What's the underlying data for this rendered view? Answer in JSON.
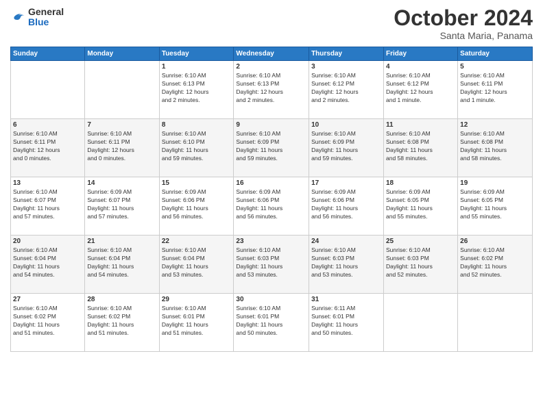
{
  "logo": {
    "general": "General",
    "blue": "Blue"
  },
  "header": {
    "month": "October 2024",
    "location": "Santa Maria, Panama"
  },
  "weekdays": [
    "Sunday",
    "Monday",
    "Tuesday",
    "Wednesday",
    "Thursday",
    "Friday",
    "Saturday"
  ],
  "weeks": [
    [
      {
        "day": "",
        "info": ""
      },
      {
        "day": "",
        "info": ""
      },
      {
        "day": "1",
        "info": "Sunrise: 6:10 AM\nSunset: 6:13 PM\nDaylight: 12 hours\nand 2 minutes."
      },
      {
        "day": "2",
        "info": "Sunrise: 6:10 AM\nSunset: 6:13 PM\nDaylight: 12 hours\nand 2 minutes."
      },
      {
        "day": "3",
        "info": "Sunrise: 6:10 AM\nSunset: 6:12 PM\nDaylight: 12 hours\nand 2 minutes."
      },
      {
        "day": "4",
        "info": "Sunrise: 6:10 AM\nSunset: 6:12 PM\nDaylight: 12 hours\nand 1 minute."
      },
      {
        "day": "5",
        "info": "Sunrise: 6:10 AM\nSunset: 6:11 PM\nDaylight: 12 hours\nand 1 minute."
      }
    ],
    [
      {
        "day": "6",
        "info": "Sunrise: 6:10 AM\nSunset: 6:11 PM\nDaylight: 12 hours\nand 0 minutes."
      },
      {
        "day": "7",
        "info": "Sunrise: 6:10 AM\nSunset: 6:11 PM\nDaylight: 12 hours\nand 0 minutes."
      },
      {
        "day": "8",
        "info": "Sunrise: 6:10 AM\nSunset: 6:10 PM\nDaylight: 11 hours\nand 59 minutes."
      },
      {
        "day": "9",
        "info": "Sunrise: 6:10 AM\nSunset: 6:09 PM\nDaylight: 11 hours\nand 59 minutes."
      },
      {
        "day": "10",
        "info": "Sunrise: 6:10 AM\nSunset: 6:09 PM\nDaylight: 11 hours\nand 59 minutes."
      },
      {
        "day": "11",
        "info": "Sunrise: 6:10 AM\nSunset: 6:08 PM\nDaylight: 11 hours\nand 58 minutes."
      },
      {
        "day": "12",
        "info": "Sunrise: 6:10 AM\nSunset: 6:08 PM\nDaylight: 11 hours\nand 58 minutes."
      }
    ],
    [
      {
        "day": "13",
        "info": "Sunrise: 6:10 AM\nSunset: 6:07 PM\nDaylight: 11 hours\nand 57 minutes."
      },
      {
        "day": "14",
        "info": "Sunrise: 6:09 AM\nSunset: 6:07 PM\nDaylight: 11 hours\nand 57 minutes."
      },
      {
        "day": "15",
        "info": "Sunrise: 6:09 AM\nSunset: 6:06 PM\nDaylight: 11 hours\nand 56 minutes."
      },
      {
        "day": "16",
        "info": "Sunrise: 6:09 AM\nSunset: 6:06 PM\nDaylight: 11 hours\nand 56 minutes."
      },
      {
        "day": "17",
        "info": "Sunrise: 6:09 AM\nSunset: 6:06 PM\nDaylight: 11 hours\nand 56 minutes."
      },
      {
        "day": "18",
        "info": "Sunrise: 6:09 AM\nSunset: 6:05 PM\nDaylight: 11 hours\nand 55 minutes."
      },
      {
        "day": "19",
        "info": "Sunrise: 6:09 AM\nSunset: 6:05 PM\nDaylight: 11 hours\nand 55 minutes."
      }
    ],
    [
      {
        "day": "20",
        "info": "Sunrise: 6:10 AM\nSunset: 6:04 PM\nDaylight: 11 hours\nand 54 minutes."
      },
      {
        "day": "21",
        "info": "Sunrise: 6:10 AM\nSunset: 6:04 PM\nDaylight: 11 hours\nand 54 minutes."
      },
      {
        "day": "22",
        "info": "Sunrise: 6:10 AM\nSunset: 6:04 PM\nDaylight: 11 hours\nand 53 minutes."
      },
      {
        "day": "23",
        "info": "Sunrise: 6:10 AM\nSunset: 6:03 PM\nDaylight: 11 hours\nand 53 minutes."
      },
      {
        "day": "24",
        "info": "Sunrise: 6:10 AM\nSunset: 6:03 PM\nDaylight: 11 hours\nand 53 minutes."
      },
      {
        "day": "25",
        "info": "Sunrise: 6:10 AM\nSunset: 6:03 PM\nDaylight: 11 hours\nand 52 minutes."
      },
      {
        "day": "26",
        "info": "Sunrise: 6:10 AM\nSunset: 6:02 PM\nDaylight: 11 hours\nand 52 minutes."
      }
    ],
    [
      {
        "day": "27",
        "info": "Sunrise: 6:10 AM\nSunset: 6:02 PM\nDaylight: 11 hours\nand 51 minutes."
      },
      {
        "day": "28",
        "info": "Sunrise: 6:10 AM\nSunset: 6:02 PM\nDaylight: 11 hours\nand 51 minutes."
      },
      {
        "day": "29",
        "info": "Sunrise: 6:10 AM\nSunset: 6:01 PM\nDaylight: 11 hours\nand 51 minutes."
      },
      {
        "day": "30",
        "info": "Sunrise: 6:10 AM\nSunset: 6:01 PM\nDaylight: 11 hours\nand 50 minutes."
      },
      {
        "day": "31",
        "info": "Sunrise: 6:11 AM\nSunset: 6:01 PM\nDaylight: 11 hours\nand 50 minutes."
      },
      {
        "day": "",
        "info": ""
      },
      {
        "day": "",
        "info": ""
      }
    ]
  ]
}
